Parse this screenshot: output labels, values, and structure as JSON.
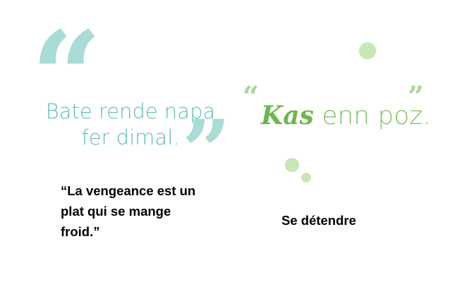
{
  "left_card": {
    "open_quote": "“",
    "close_quote": "”",
    "creole_lines": [
      "Bate rende napa",
      "fer dimal."
    ],
    "french_lines": [
      "“La vengeance est un",
      "plat qui se mange",
      "froid.”"
    ]
  },
  "right_card": {
    "open_quote": "“",
    "close_quote": "”",
    "creole_emphasis": "Kas",
    "creole_rest": " enn poz.",
    "french": "Se détendre"
  },
  "colors": {
    "teal_quote": "#a8dcd6",
    "teal_text": "#5bc0b5",
    "green_text": "#82c564",
    "green_dot": "#c7e8b4"
  }
}
